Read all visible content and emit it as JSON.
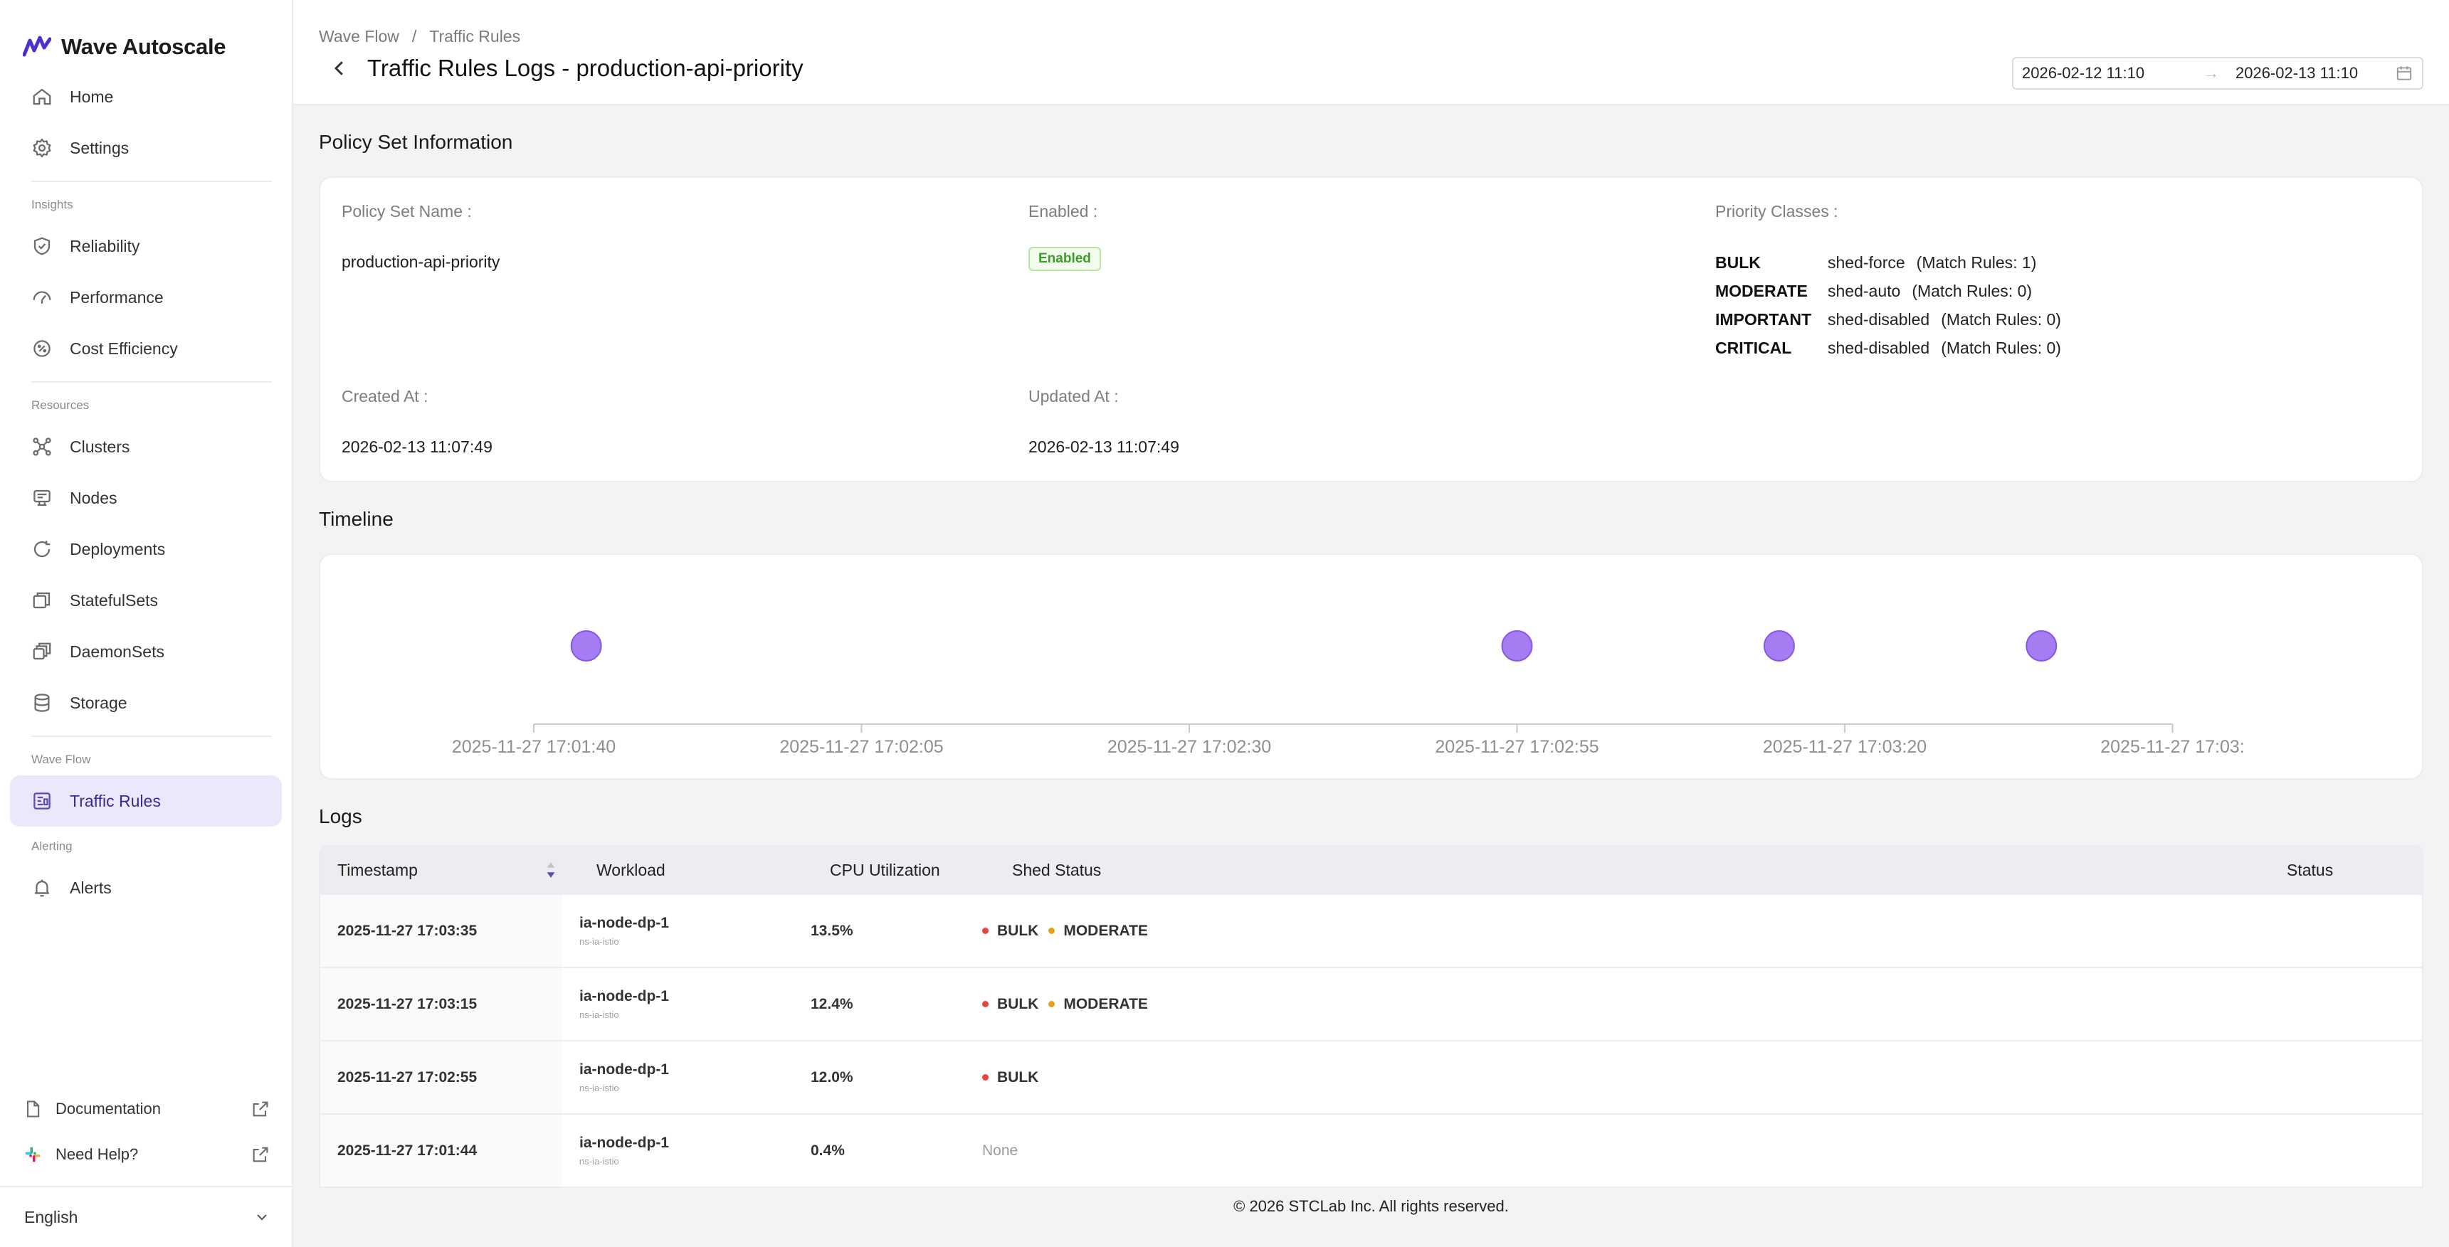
{
  "app": {
    "name": "Wave Autoscale"
  },
  "sidebar": {
    "top_items": [
      {
        "label": "Home",
        "icon": "home-icon"
      },
      {
        "label": "Settings",
        "icon": "gear-icon"
      }
    ],
    "sections": [
      {
        "label": "Insights",
        "items": [
          {
            "label": "Reliability",
            "icon": "shield-check-icon"
          },
          {
            "label": "Performance",
            "icon": "gauge-icon"
          },
          {
            "label": "Cost Efficiency",
            "icon": "cost-icon"
          }
        ]
      },
      {
        "label": "Resources",
        "items": [
          {
            "label": "Clusters",
            "icon": "cluster-icon"
          },
          {
            "label": "Nodes",
            "icon": "node-icon"
          },
          {
            "label": "Deployments",
            "icon": "deployment-icon"
          },
          {
            "label": "StatefulSets",
            "icon": "statefulset-icon"
          },
          {
            "label": "DaemonSets",
            "icon": "daemonset-icon"
          },
          {
            "label": "Storage",
            "icon": "database-icon"
          }
        ]
      },
      {
        "label": "Wave Flow",
        "items": [
          {
            "label": "Traffic Rules",
            "icon": "traffic-rules-icon",
            "active": true
          }
        ]
      },
      {
        "label": "Alerting",
        "items": [
          {
            "label": "Alerts",
            "icon": "bell-icon"
          }
        ]
      }
    ],
    "documentation": "Documentation",
    "help": "Need Help?",
    "language": "English"
  },
  "header": {
    "breadcrumb": [
      "Wave Flow",
      "Traffic Rules"
    ],
    "breadcrumb_sep": "/",
    "title": "Traffic Rules Logs - production-api-priority",
    "date_from": "2026-02-12 11:10",
    "date_arrow": "→",
    "date_to": "2026-02-13 11:10"
  },
  "policy": {
    "section_title": "Policy Set Information",
    "name_label": "Policy Set Name :",
    "name_value": "production-api-priority",
    "enabled_label": "Enabled :",
    "enabled_value": "Enabled",
    "priority_label": "Priority Classes :",
    "priority_classes": [
      {
        "cls": "BULK",
        "mode": "shed-force",
        "rules": "(Match Rules: 1)"
      },
      {
        "cls": "MODERATE",
        "mode": "shed-auto",
        "rules": "(Match Rules: 0)"
      },
      {
        "cls": "IMPORTANT",
        "mode": "shed-disabled",
        "rules": "(Match Rules: 0)"
      },
      {
        "cls": "CRITICAL",
        "mode": "shed-disabled",
        "rules": "(Match Rules: 0)"
      }
    ],
    "created_label": "Created At :",
    "created_value": "2026-02-13 11:07:49",
    "updated_label": "Updated At :",
    "updated_value": "2026-02-13 11:07:49"
  },
  "timeline": {
    "section_title": "Timeline",
    "ticks": [
      "2025-11-27 17:01:40",
      "2025-11-27 17:02:05",
      "2025-11-27 17:02:30",
      "2025-11-27 17:02:55",
      "2025-11-27 17:03:20",
      "2025-11-27 17:03:"
    ],
    "tick_seconds": [
      0,
      25,
      50,
      75,
      100,
      125
    ],
    "events_seconds": [
      4,
      75,
      95,
      115
    ],
    "event_color": "#a57df2"
  },
  "logs": {
    "section_title": "Logs",
    "columns": {
      "timestamp": "Timestamp",
      "workload": "Workload",
      "cpu": "CPU Utilization",
      "shed": "Shed Status",
      "status": "Status"
    },
    "rows": [
      {
        "timestamp": "2025-11-27 17:03:35",
        "workload": "ia-node-dp-1",
        "namespace": "ns-ia-istio",
        "cpu": "13.5%",
        "shed": [
          "BULK",
          "MODERATE"
        ]
      },
      {
        "timestamp": "2025-11-27 17:03:15",
        "workload": "ia-node-dp-1",
        "namespace": "ns-ia-istio",
        "cpu": "12.4%",
        "shed": [
          "BULK",
          "MODERATE"
        ]
      },
      {
        "timestamp": "2025-11-27 17:02:55",
        "workload": "ia-node-dp-1",
        "namespace": "ns-ia-istio",
        "cpu": "12.0%",
        "shed": [
          "BULK"
        ]
      },
      {
        "timestamp": "2025-11-27 17:01:44",
        "workload": "ia-node-dp-1",
        "namespace": "ns-ia-istio",
        "cpu": "0.4%",
        "shed": [],
        "shed_none": "None"
      }
    ]
  },
  "colors": {
    "accent": "#5a4ab8",
    "bulk": "#e8433f",
    "moderate": "#e6a21d",
    "enabled": "#3b9e27"
  },
  "footer": "© 2026 STCLab Inc. All rights reserved."
}
